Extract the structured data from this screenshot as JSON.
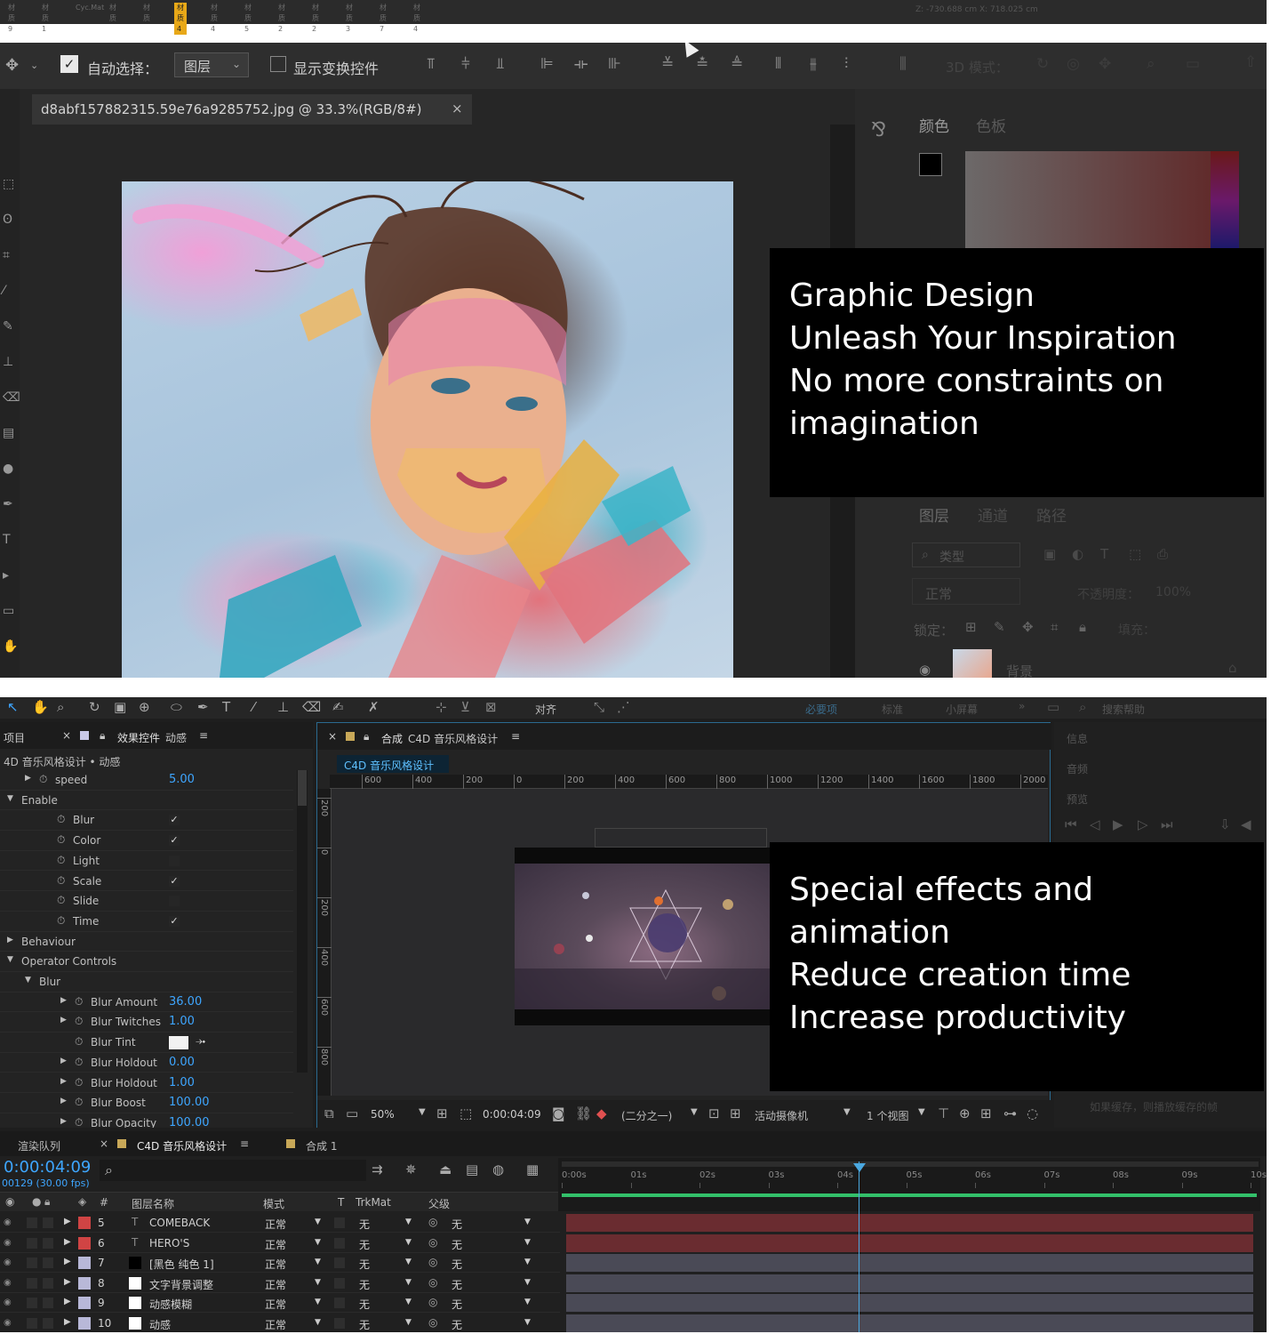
{
  "strip": {
    "tabs": [
      "材质9",
      "材质1",
      "Cyc.Mat",
      "材质",
      "材质",
      "材质4",
      "材质4",
      "材质5",
      "材质2",
      "材质2",
      "材质3",
      "材质7",
      "材质4"
    ],
    "readout": "Z: -730.688 cm  X: 718.025 cm"
  },
  "photoshop": {
    "options": {
      "auto_select_label": "自动选择：",
      "layer_select": "图层",
      "show_transform": "显示变换控件",
      "mode_3d": "3D 模式："
    },
    "doc_tab": "d8abf157882315.59e76a9285752.jpg @ 33.3%(RGB/8#)",
    "doc_close": "×",
    "color_tabs": [
      "颜色",
      "色板"
    ],
    "layers_tabs": [
      "图层",
      "通道",
      "路径"
    ],
    "filter_label": "类型",
    "blend_mode": "正常",
    "opacity_label": "不透明度：",
    "opacity_value": "100%",
    "lock_label": "锁定：",
    "fill_label": "填充：",
    "layer_name": "背景"
  },
  "caption1": {
    "line1": "Graphic Design",
    "line2": "Unleash Your Inspiration",
    "line3": "No more constraints on",
    "line4": "imagination"
  },
  "caption2": {
    "line1": "Special effects and",
    "line2": "animation",
    "line3": "Reduce creation time",
    "line4": "Increase productivity"
  },
  "ae": {
    "toolbar": {
      "align": "对齐",
      "workspace": [
        "必要项",
        "标准",
        "小屏幕"
      ],
      "search": "搜索帮助"
    },
    "project_tab": "项目",
    "effects_tab": "效果控件",
    "effects_tab_target": "动感",
    "effects_path": "4D 音乐风格设计 • 动感",
    "props": [
      {
        "name": "speed",
        "value": "5.00",
        "indent": 2,
        "arrow": "▶"
      },
      {
        "name": "Enable",
        "value": "",
        "indent": 1,
        "arrow": "▼"
      },
      {
        "name": "Blur",
        "check": "✓",
        "indent": 3
      },
      {
        "name": "Color",
        "check": "✓",
        "indent": 3
      },
      {
        "name": "Light",
        "check": "",
        "indent": 3
      },
      {
        "name": "Scale",
        "check": "✓",
        "indent": 3
      },
      {
        "name": "Slide",
        "check": "",
        "indent": 3
      },
      {
        "name": "Time",
        "check": "✓",
        "indent": 3
      },
      {
        "name": "Behaviour",
        "value": "",
        "indent": 1,
        "arrow": "▶"
      },
      {
        "name": "Operator Controls",
        "value": "",
        "indent": 1,
        "arrow": "▼"
      },
      {
        "name": "Blur",
        "value": "",
        "indent": 2,
        "arrow": "▼"
      },
      {
        "name": "Blur Amount",
        "value": "36.00",
        "indent": 4,
        "arrow": "▶"
      },
      {
        "name": "Blur Twitches",
        "value": "1.00",
        "indent": 4,
        "arrow": "▶"
      },
      {
        "name": "Blur Tint",
        "swatch": "#f2f2f2",
        "indent": 4
      },
      {
        "name": "Blur Holdout",
        "value": "0.00",
        "indent": 4,
        "arrow": "▶"
      },
      {
        "name": "Blur Holdout",
        "value": "1.00",
        "indent": 4,
        "arrow": "▶"
      },
      {
        "name": "Blur Boost",
        "value": "100.00",
        "indent": 4,
        "arrow": "▶"
      },
      {
        "name": "Blur Opacity",
        "value": "100.00",
        "indent": 4,
        "arrow": "▶"
      }
    ],
    "comp_tab_prefix": "合成",
    "comp_tab_name": "C4D 音乐风格设计",
    "comp_label": "C4D 音乐风格设计",
    "ruler_h": [
      "600",
      "400",
      "200",
      "0",
      "200",
      "400",
      "600",
      "800",
      "1000",
      "1200",
      "1400",
      "1600",
      "1800",
      "2000"
    ],
    "ruler_v": [
      "200",
      "0",
      "200",
      "400",
      "600",
      "800"
    ],
    "viewer_bar": {
      "zoom": "50%",
      "timecode": "0:00:04:09",
      "resolution": "(二分之一)",
      "camera": "活动摄像机",
      "views": "1 个视图"
    },
    "right_panels": [
      "信息",
      "音频",
      "预览"
    ],
    "right_note": "如果缓存，则播放缓存的帧",
    "render_queue": "渲染队列",
    "timeline_tab": "C4D 音乐风格设计",
    "timeline_tab2": "合成 1",
    "timecode": "0:00:04:09",
    "frames": "00129 (30.00 fps)",
    "cols": {
      "num": "#",
      "name": "图层名称",
      "mode": "模式",
      "t": "T",
      "trkmat": "TrkMat",
      "parent": "父级"
    },
    "time_ticks": [
      "0:00s",
      "01s",
      "02s",
      "03s",
      "04s",
      "05s",
      "06s",
      "07s",
      "08s",
      "09s",
      "10s"
    ],
    "layers": [
      {
        "num": "5",
        "name": "COMEBACK",
        "label": "#d04444",
        "mode": "正常",
        "trk": "无",
        "parent": "无",
        "icon": "T",
        "swatch": "",
        "bar": "#6a2c30"
      },
      {
        "num": "6",
        "name": "HERO'S",
        "label": "#d04444",
        "mode": "正常",
        "trk": "无",
        "parent": "无",
        "icon": "T",
        "swatch": "",
        "bar": "#6a2c30"
      },
      {
        "num": "7",
        "name": "[黑色 纯色 1]",
        "label": "#b8b8d8",
        "mode": "正常",
        "trk": "无",
        "parent": "无",
        "icon": "",
        "swatch": "#000000",
        "bar": "#4a4a56"
      },
      {
        "num": "8",
        "name": "文字背景调整",
        "label": "#b8b8d8",
        "mode": "正常",
        "trk": "无",
        "parent": "无",
        "icon": "",
        "swatch": "#ffffff",
        "bar": "#4a4a56"
      },
      {
        "num": "9",
        "name": "动感模糊",
        "label": "#b8b8d8",
        "mode": "正常",
        "trk": "无",
        "parent": "无",
        "icon": "",
        "swatch": "#ffffff",
        "bar": "#4a4a56"
      },
      {
        "num": "10",
        "name": "动感",
        "label": "#b8b8d8",
        "mode": "正常",
        "trk": "无",
        "parent": "无",
        "icon": "",
        "swatch": "#ffffff",
        "bar": "#4a4a56"
      }
    ]
  },
  "colors": {
    "ae_accent": "#3ea6ff",
    "playhead": "#4aa8e0",
    "work_area": "#33c06a"
  }
}
